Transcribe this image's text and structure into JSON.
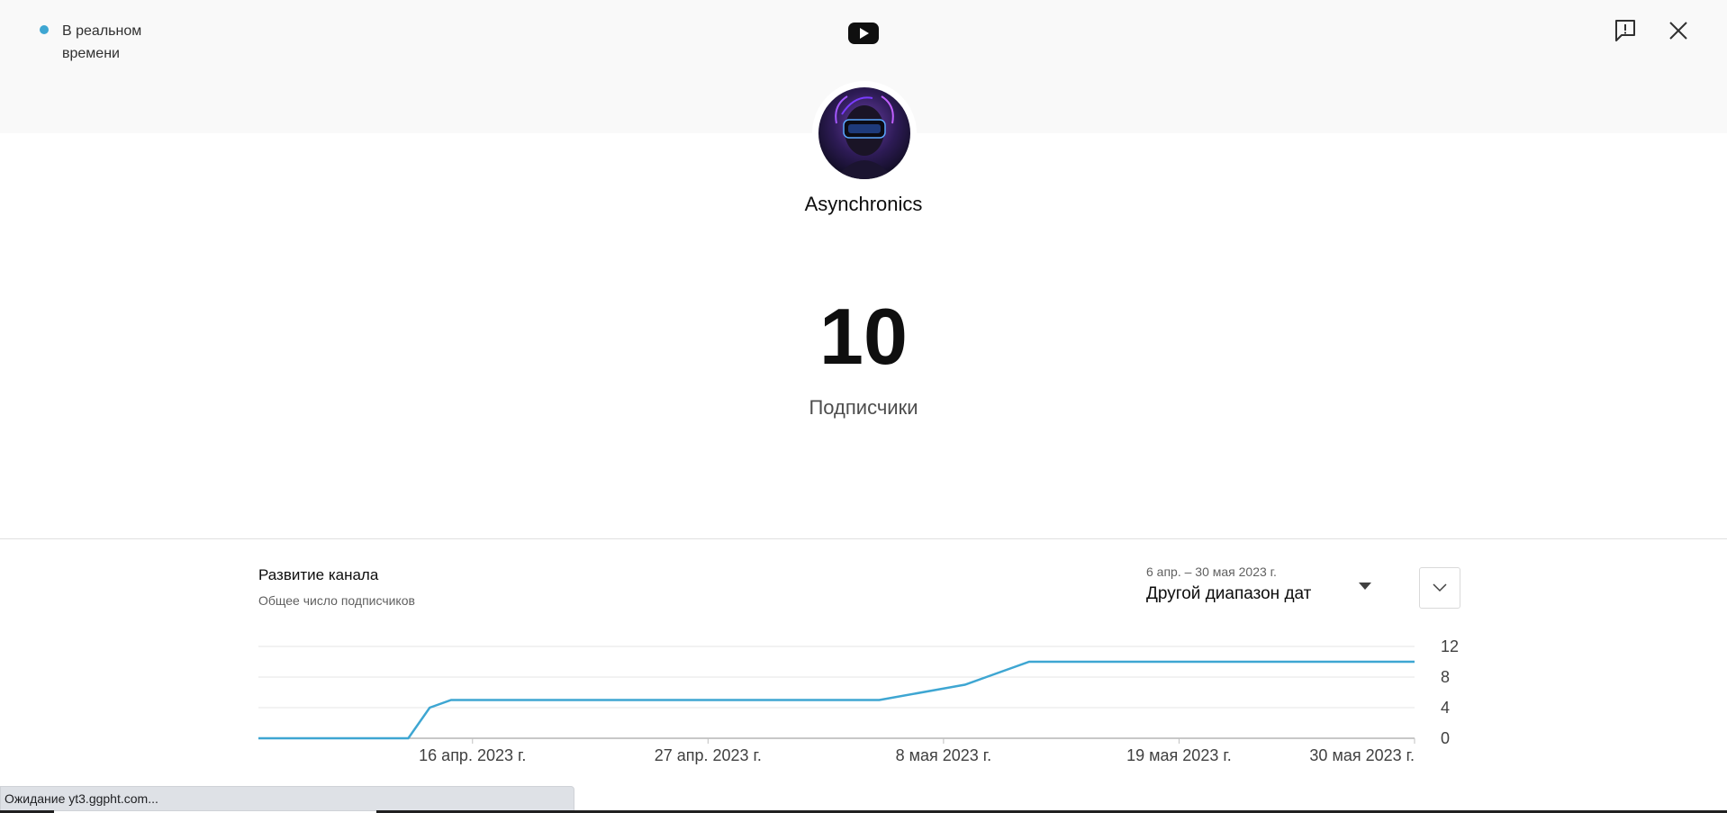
{
  "header": {
    "live_label": "В реальном времени",
    "logo_icon": "youtube-icon",
    "feedback_icon": "feedback-icon",
    "close_icon": "close-icon"
  },
  "channel": {
    "name": "Asynchronics",
    "avatar_icon": "channel-avatar"
  },
  "metric": {
    "value": "10",
    "label": "Подписчики"
  },
  "panel": {
    "title": "Развитие канала",
    "subtitle": "Общее число подписчиков",
    "date_range_small": "6 апр. – 30 мая 2023 г.",
    "date_range_label": "Другой диапазон дат"
  },
  "chart_data": {
    "type": "line",
    "x": [
      "6 апр.",
      "13 апр.",
      "14 апр.",
      "15 апр.",
      "5 мая",
      "9 мая",
      "10 мая",
      "12 мая",
      "30 мая"
    ],
    "values": [
      0,
      0,
      4,
      5,
      5,
      7,
      8,
      10,
      10
    ],
    "tick_labels_x": [
      "16 апр. 2023 г.",
      "27 апр. 2023 г.",
      "8 мая 2023 г.",
      "19 мая 2023 г.",
      "30 мая 2023 г."
    ],
    "tick_labels_y": [
      "12",
      "8",
      "4",
      "0"
    ],
    "ylim": [
      0,
      12
    ],
    "grid": true,
    "color": "#3ea6d2"
  },
  "status": {
    "text": "Ожидание yt3.ggpht.com..."
  },
  "colors": {
    "accent": "#3ea6d2",
    "background_top": "#f9f9f9"
  }
}
